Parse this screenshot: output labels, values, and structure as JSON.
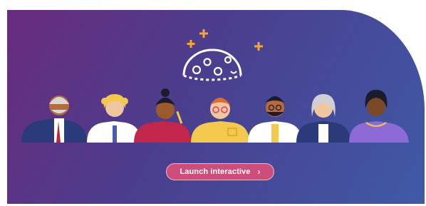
{
  "banner": {
    "cta_label": "Launch interactive",
    "cta_icon": "chevron-right-icon",
    "brand_logo": "moon-with-stars-icon",
    "colors": {
      "gradient_start": "#6a2b7d",
      "gradient_mid": "#4a3f8e",
      "gradient_end": "#3f5aa7",
      "button_bg": "#cf4d7b",
      "star_accent": "#f7a23b"
    }
  }
}
